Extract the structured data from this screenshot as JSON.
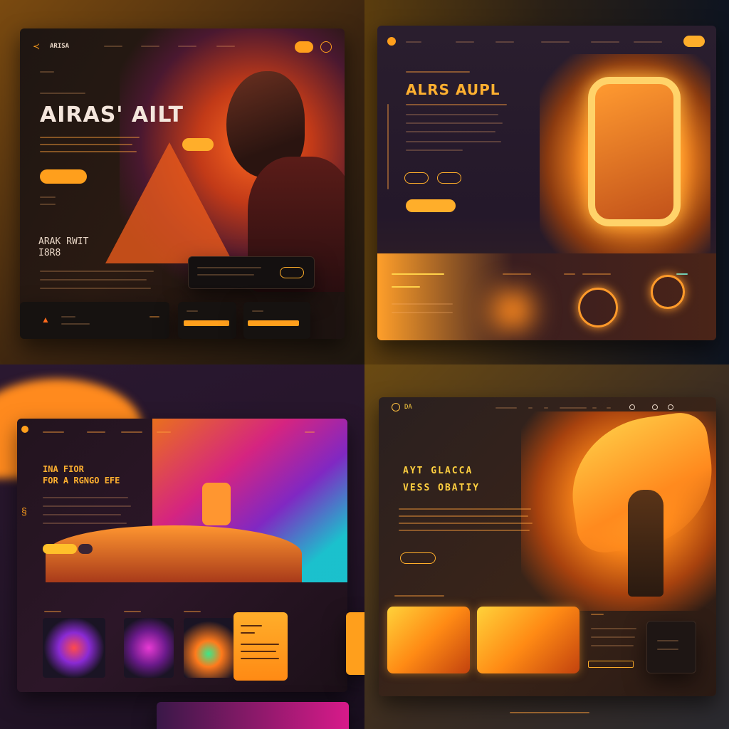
{
  "panels": [
    {
      "id": "panel-1",
      "logo_text": "ARISA",
      "hero_title": "AIRAS' AILT",
      "secondary_title_line1": "ARAK RWIT",
      "secondary_title_line2": "I8R8",
      "accent_color": "#ff9f1c"
    },
    {
      "id": "panel-2",
      "hero_title": "ALRS AUPL",
      "accent_color": "#ffb030"
    },
    {
      "id": "panel-3",
      "hero_title_line1": "INA FIOR",
      "hero_title_line2": "FOR A RGNGO EFE",
      "accent_color": "#ffb030"
    },
    {
      "id": "panel-4",
      "logo_text": "DA",
      "hero_title_line1": "AYT GLACCA",
      "hero_title_line2": "VESS OBATIY",
      "accent_color": "#ffd040"
    }
  ]
}
